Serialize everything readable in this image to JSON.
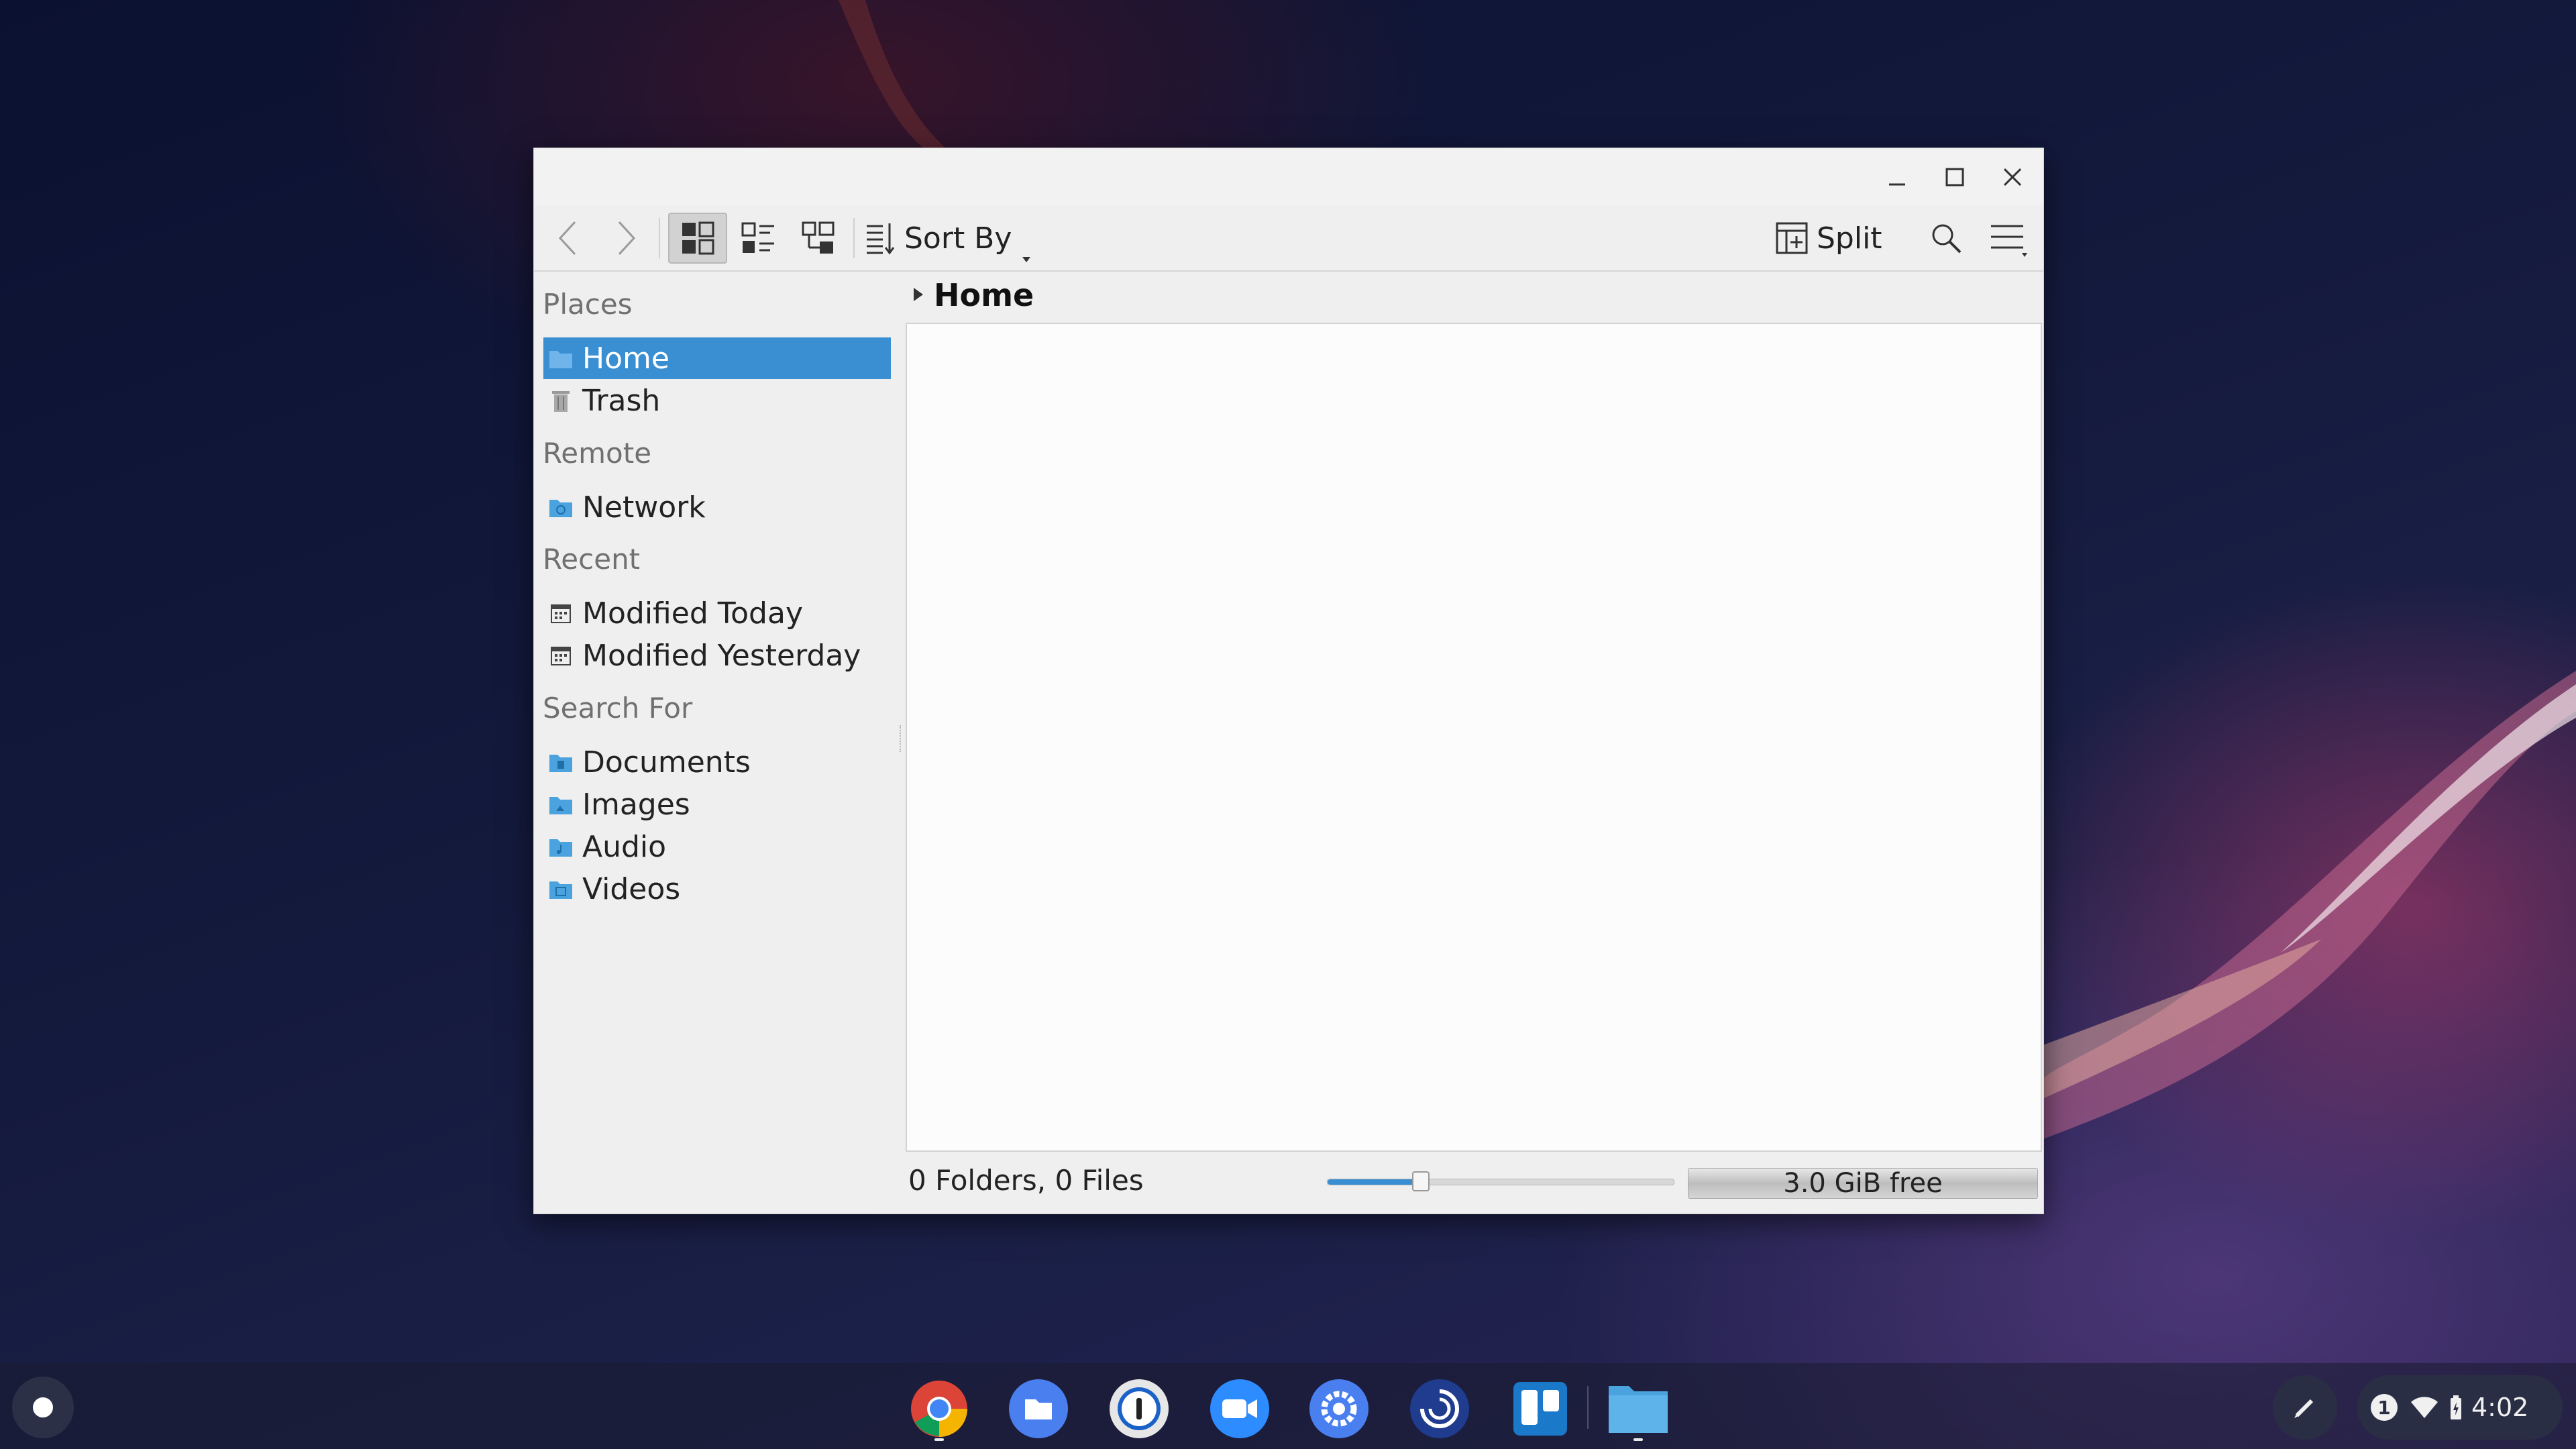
{
  "window": {
    "toolbar": {
      "sort_label": "Sort By",
      "split_label": "Split"
    },
    "sidebar": {
      "sections": [
        {
          "title": "Places",
          "items": [
            {
              "label": "Home",
              "icon": "home-folder-icon",
              "selected": true
            },
            {
              "label": "Trash",
              "icon": "trash-icon"
            }
          ]
        },
        {
          "title": "Remote",
          "items": [
            {
              "label": "Network",
              "icon": "network-folder-icon"
            }
          ]
        },
        {
          "title": "Recent",
          "items": [
            {
              "label": "Modified Today",
              "icon": "calendar-icon"
            },
            {
              "label": "Modified Yesterday",
              "icon": "calendar-icon"
            }
          ]
        },
        {
          "title": "Search For",
          "items": [
            {
              "label": "Documents",
              "icon": "documents-folder-icon"
            },
            {
              "label": "Images",
              "icon": "images-folder-icon"
            },
            {
              "label": "Audio",
              "icon": "audio-folder-icon"
            },
            {
              "label": "Videos",
              "icon": "videos-folder-icon"
            }
          ]
        }
      ]
    },
    "breadcrumb": {
      "current": "Home"
    },
    "status": {
      "summary": "0 Folders, 0 Files",
      "zoom_level_fraction": 0.27,
      "free_space": "3.0 GiB free"
    }
  },
  "shelf": {
    "apps": [
      {
        "name": "chrome",
        "icon": "chrome-icon",
        "running": true
      },
      {
        "name": "files",
        "icon": "files-icon"
      },
      {
        "name": "1password",
        "icon": "password-manager-icon"
      },
      {
        "name": "zoom",
        "icon": "video-camera-icon"
      },
      {
        "name": "settings",
        "icon": "gear-icon"
      },
      {
        "name": "gitkraken",
        "icon": "swirl-icon"
      },
      {
        "name": "trello",
        "icon": "board-icon"
      },
      {
        "name": "dolphin",
        "icon": "folder-icon",
        "running": true
      }
    ],
    "tray": {
      "notification_count": "1",
      "time": "4:02"
    }
  },
  "colors": {
    "accent": "#3a8fd2",
    "folder_blue": "#4aa3df"
  }
}
